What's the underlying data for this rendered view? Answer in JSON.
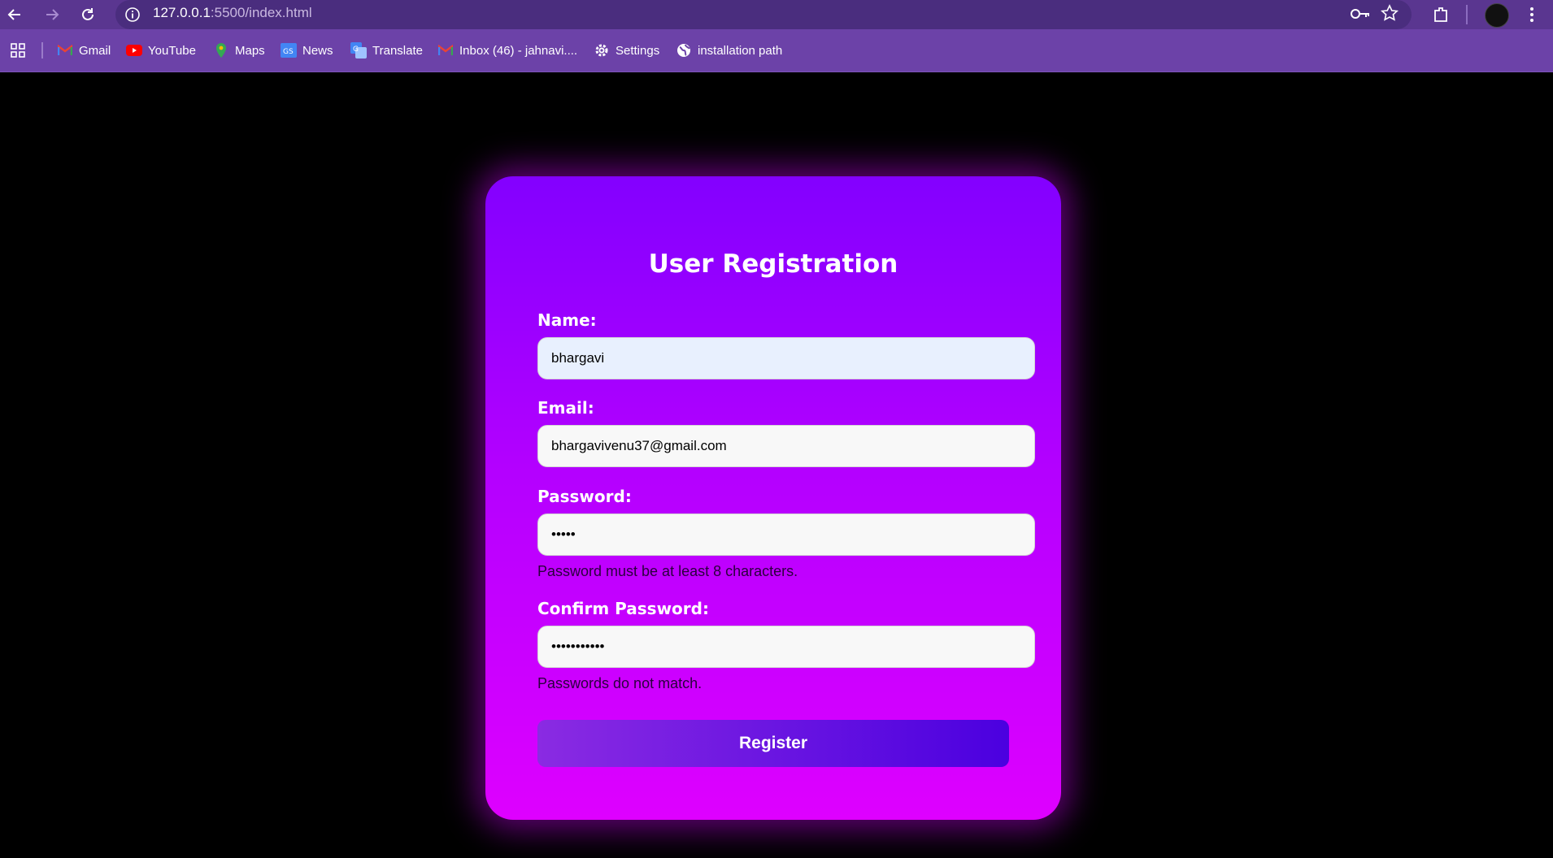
{
  "browser": {
    "url_host": "127.0.0.1",
    "url_path": ":5500/index.html",
    "bookmarks": [
      {
        "label": "Gmail",
        "icon": "gmail-icon"
      },
      {
        "label": "YouTube",
        "icon": "youtube-icon"
      },
      {
        "label": "Maps",
        "icon": "maps-icon"
      },
      {
        "label": "News",
        "icon": "news-icon"
      },
      {
        "label": "Translate",
        "icon": "translate-icon"
      },
      {
        "label": "Inbox (46) - jahnavi....",
        "icon": "gmail-icon"
      },
      {
        "label": "Settings",
        "icon": "gear-icon"
      },
      {
        "label": "installation path",
        "icon": "globe-icon"
      }
    ]
  },
  "form": {
    "title": "User Registration",
    "name_label": "Name:",
    "name_value": "bhargavi",
    "email_label": "Email:",
    "email_value": "bhargavivenu37@gmail.com",
    "password_label": "Password:",
    "password_value": "•••••",
    "password_error": "Password must be at least 8 characters.",
    "confirm_label": "Confirm Password:",
    "confirm_value": "•••••••••••",
    "confirm_error": "Passwords do not match.",
    "submit_label": "Register"
  },
  "colors": {
    "page_bg": "#000000",
    "card_top": "#8300ff",
    "card_bottom": "#de00ff",
    "button_start": "#8a2be2",
    "button_end": "#4b00e0",
    "chrome": "#6c42a8"
  }
}
